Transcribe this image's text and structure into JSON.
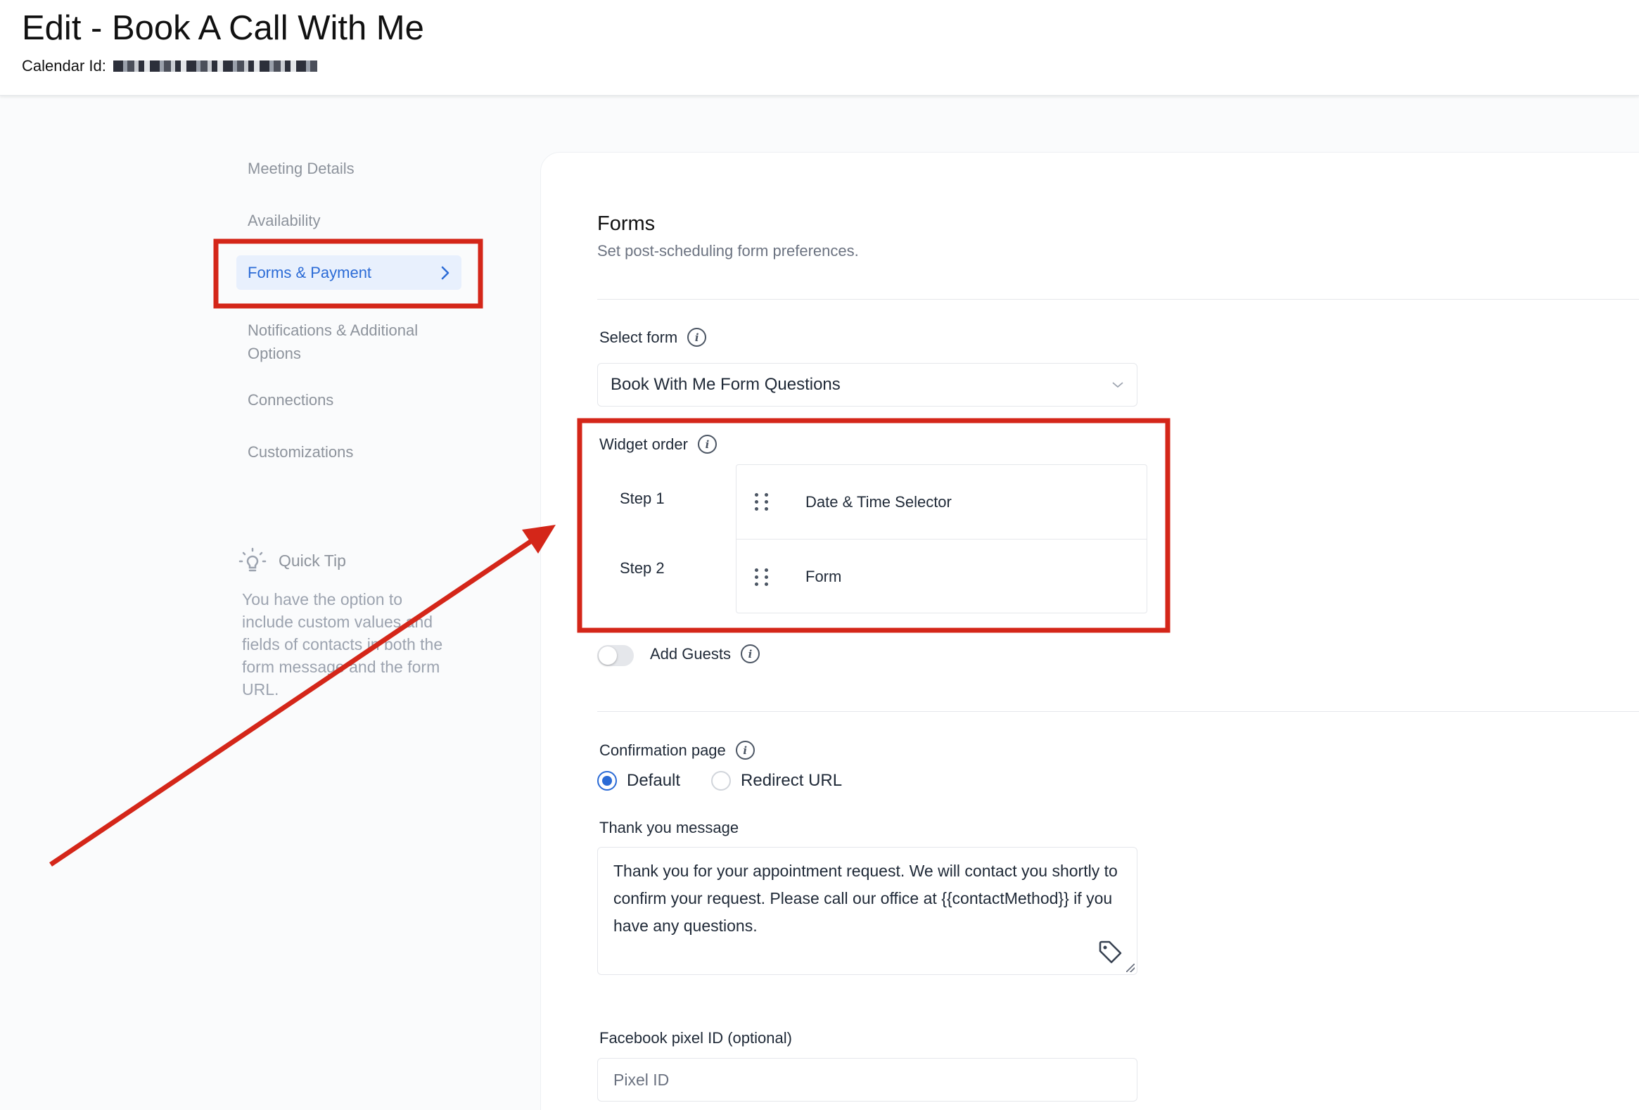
{
  "header": {
    "title": "Edit - Book A Call With Me",
    "calendar_id_label": "Calendar Id:"
  },
  "sidebar": {
    "items": [
      {
        "label": "Meeting Details"
      },
      {
        "label": "Availability"
      },
      {
        "label": "Forms & Payment",
        "active": true
      },
      {
        "label": "Notifications & Additional Options"
      },
      {
        "label": "Connections"
      },
      {
        "label": "Customizations"
      }
    ],
    "quick_tip": {
      "title": "Quick Tip",
      "body": "You have the option to include custom values and fields of contacts in both the form message and the form URL."
    }
  },
  "forms": {
    "title": "Forms",
    "subtitle": "Set post-scheduling form preferences.",
    "select_form_label": "Select form",
    "select_form_value": "Book With Me Form Questions",
    "widget_order_label": "Widget order",
    "steps": [
      {
        "step": "Step 1",
        "widget": "Date & Time Selector"
      },
      {
        "step": "Step 2",
        "widget": "Form"
      }
    ],
    "add_guests_label": "Add Guests",
    "add_guests_enabled": false,
    "confirmation_label": "Confirmation page",
    "confirmation_options": [
      {
        "label": "Default",
        "selected": true
      },
      {
        "label": "Redirect URL",
        "selected": false
      }
    ],
    "thank_you_label": "Thank you message",
    "thank_you_value": "Thank you for your appointment request. We will contact you shortly to confirm your request. Please call our office at {{contactMethod}} if you have any questions.",
    "pixel_label": "Facebook pixel ID (optional)",
    "pixel_placeholder": "Pixel ID"
  },
  "colors": {
    "accent": "#2b6bd6",
    "highlight": "#d42619"
  }
}
